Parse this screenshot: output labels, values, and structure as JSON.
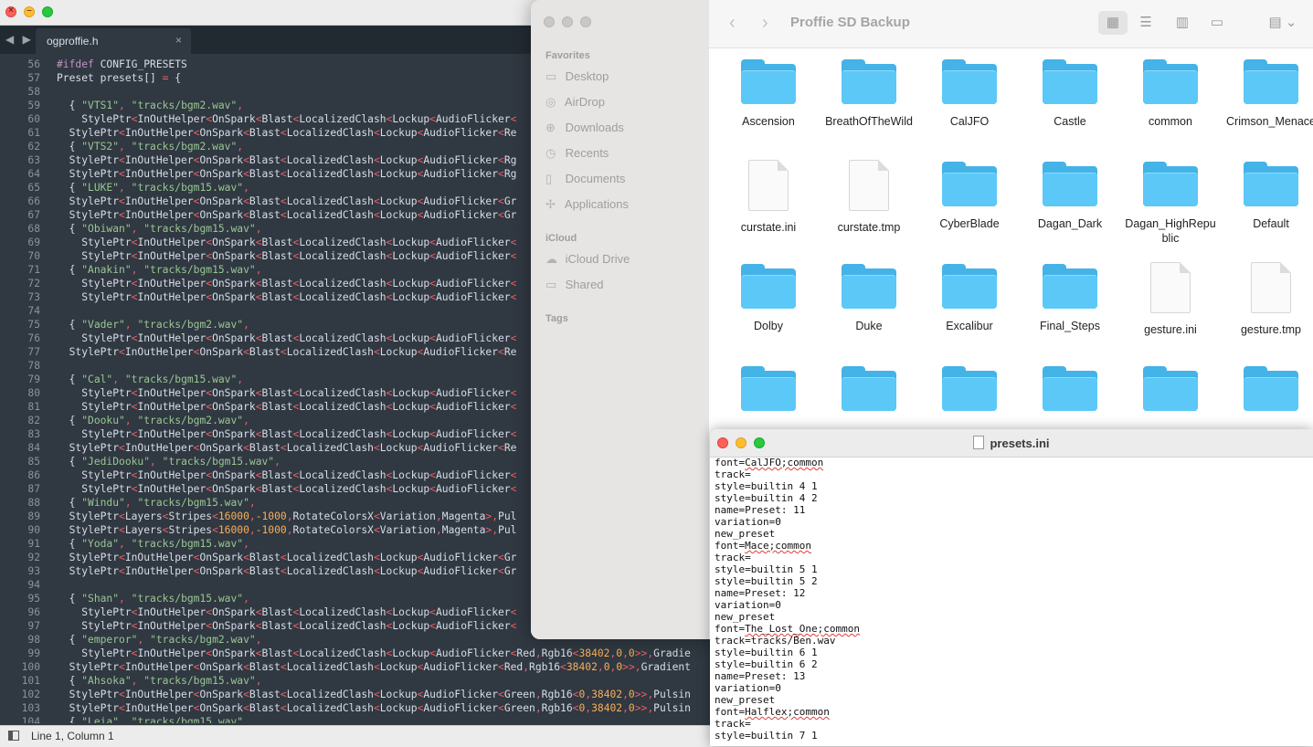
{
  "editor": {
    "tab_title": "ogproffie.h",
    "tab_close": "×",
    "tab_nav": "◀ ▶",
    "status": "Line 1, Column 1",
    "first_line": 56,
    "lines": [
      "#ifdef CONFIG_PRESETS",
      "Preset presets[] = {",
      "",
      "  { \"VTS1\", \"tracks/bgm2.wav\",",
      "    StylePtr<InOutHelper<OnSpark<Blast<LocalizedClash<Lockup<AudioFlicker<",
      "  StylePtr<InOutHelper<OnSpark<Blast<LocalizedClash<Lockup<AudioFlicker<Re",
      "  { \"VTS2\", \"tracks/bgm2.wav\",",
      "  StylePtr<InOutHelper<OnSpark<Blast<LocalizedClash<Lockup<AudioFlicker<Rg",
      "  StylePtr<InOutHelper<OnSpark<Blast<LocalizedClash<Lockup<AudioFlicker<Rg",
      "  { \"LUKE\", \"tracks/bgm15.wav\",",
      "  StylePtr<InOutHelper<OnSpark<Blast<LocalizedClash<Lockup<AudioFlicker<Gr",
      "  StylePtr<InOutHelper<OnSpark<Blast<LocalizedClash<Lockup<AudioFlicker<Gr",
      "  { \"Obiwan\", \"tracks/bgm15.wav\",",
      "    StylePtr<InOutHelper<OnSpark<Blast<LocalizedClash<Lockup<AudioFlicker<",
      "    StylePtr<InOutHelper<OnSpark<Blast<LocalizedClash<Lockup<AudioFlicker<",
      "  { \"Anakin\", \"tracks/bgm15.wav\",",
      "    StylePtr<InOutHelper<OnSpark<Blast<LocalizedClash<Lockup<AudioFlicker<",
      "    StylePtr<InOutHelper<OnSpark<Blast<LocalizedClash<Lockup<AudioFlicker<",
      "",
      "  { \"Vader\", \"tracks/bgm2.wav\",",
      "    StylePtr<InOutHelper<OnSpark<Blast<LocalizedClash<Lockup<AudioFlicker<",
      "  StylePtr<InOutHelper<OnSpark<Blast<LocalizedClash<Lockup<AudioFlicker<Re",
      "",
      "  { \"Cal\", \"tracks/bgm15.wav\",",
      "    StylePtr<InOutHelper<OnSpark<Blast<LocalizedClash<Lockup<AudioFlicker<",
      "    StylePtr<InOutHelper<OnSpark<Blast<LocalizedClash<Lockup<AudioFlicker<",
      "  { \"Dooku\", \"tracks/bgm2.wav\",",
      "    StylePtr<InOutHelper<OnSpark<Blast<LocalizedClash<Lockup<AudioFlicker<",
      "  StylePtr<InOutHelper<OnSpark<Blast<LocalizedClash<Lockup<AudioFlicker<Re",
      "  { \"JediDooku\", \"tracks/bgm15.wav\",",
      "    StylePtr<InOutHelper<OnSpark<Blast<LocalizedClash<Lockup<AudioFlicker<",
      "    StylePtr<InOutHelper<OnSpark<Blast<LocalizedClash<Lockup<AudioFlicker<",
      "  { \"Windu\", \"tracks/bgm15.wav\",",
      "  StylePtr<Layers<Stripes<16000,-1000,RotateColorsX<Variation,Magenta>,Pul",
      "  StylePtr<Layers<Stripes<16000,-1000,RotateColorsX<Variation,Magenta>,Pul",
      "  { \"Yoda\", \"tracks/bgm15.wav\",",
      "  StylePtr<InOutHelper<OnSpark<Blast<LocalizedClash<Lockup<AudioFlicker<Gr",
      "  StylePtr<InOutHelper<OnSpark<Blast<LocalizedClash<Lockup<AudioFlicker<Gr",
      "",
      "  { \"Shan\", \"tracks/bgm15.wav\",",
      "    StylePtr<InOutHelper<OnSpark<Blast<LocalizedClash<Lockup<AudioFlicker<",
      "    StylePtr<InOutHelper<OnSpark<Blast<LocalizedClash<Lockup<AudioFlicker<",
      "  { \"emperor\", \"tracks/bgm2.wav\",",
      "    StylePtr<InOutHelper<OnSpark<Blast<LocalizedClash<Lockup<AudioFlicker<Red,Rgb16<38402,0,0>>,Gradie",
      "  StylePtr<InOutHelper<OnSpark<Blast<LocalizedClash<Lockup<AudioFlicker<Red,Rgb16<38402,0,0>>,Gradient",
      "  { \"Ahsoka\", \"tracks/bgm15.wav\",",
      "  StylePtr<InOutHelper<OnSpark<Blast<LocalizedClash<Lockup<AudioFlicker<Green,Rgb16<0,38402,0>>,Pulsin",
      "  StylePtr<InOutHelper<OnSpark<Blast<LocalizedClash<Lockup<AudioFlicker<Green,Rgb16<0,38402,0>>,Pulsin",
      "  { \"Leia\", \"tracks/bgm15.wav\","
    ]
  },
  "finder": {
    "title": "Proffie SD Backup",
    "nav_back": "‹",
    "nav_forward": "›",
    "sidebar": {
      "favorites_heading": "Favorites",
      "favorites": [
        {
          "label": "Desktop",
          "icon": "▭"
        },
        {
          "label": "AirDrop",
          "icon": "◎"
        },
        {
          "label": "Downloads",
          "icon": "⊕"
        },
        {
          "label": "Recents",
          "icon": "◷"
        },
        {
          "label": "Documents",
          "icon": "▯"
        },
        {
          "label": "Applications",
          "icon": "✢"
        }
      ],
      "icloud_heading": "iCloud",
      "icloud": [
        {
          "label": "iCloud Drive",
          "icon": "☁"
        },
        {
          "label": "Shared",
          "icon": "▭"
        }
      ],
      "tags_heading": "Tags"
    },
    "view_buttons": [
      "▦",
      "☰",
      "▥",
      "▭",
      "▤ ⌄"
    ],
    "items": [
      {
        "name": "Ascension",
        "kind": "folder"
      },
      {
        "name": "BreathOfTheWild",
        "kind": "folder"
      },
      {
        "name": "CalJFO",
        "kind": "folder"
      },
      {
        "name": "Castle",
        "kind": "folder"
      },
      {
        "name": "common",
        "kind": "folder"
      },
      {
        "name": "Crimson_Menace",
        "kind": "folder"
      },
      {
        "name": "curstate.ini",
        "kind": "file"
      },
      {
        "name": "curstate.tmp",
        "kind": "file"
      },
      {
        "name": "CyberBlade",
        "kind": "folder"
      },
      {
        "name": "Dagan_Dark",
        "kind": "folder"
      },
      {
        "name": "Dagan_HighRepublic",
        "kind": "folder"
      },
      {
        "name": "Default",
        "kind": "folder"
      },
      {
        "name": "Dolby",
        "kind": "folder"
      },
      {
        "name": "Duke",
        "kind": "folder"
      },
      {
        "name": "Excalibur",
        "kind": "folder"
      },
      {
        "name": "Final_Steps",
        "kind": "folder"
      },
      {
        "name": "gesture.ini",
        "kind": "file"
      },
      {
        "name": "gesture.tmp",
        "kind": "file"
      },
      {
        "name": "",
        "kind": "folder"
      },
      {
        "name": "",
        "kind": "folder"
      },
      {
        "name": "",
        "kind": "folder"
      },
      {
        "name": "",
        "kind": "folder"
      },
      {
        "name": "",
        "kind": "folder"
      },
      {
        "name": "",
        "kind": "folder"
      }
    ]
  },
  "ini": {
    "title": "presets.ini",
    "lines": [
      "font=CalJFO;common",
      "track=",
      "style=builtin 4 1",
      "style=builtin 4 2",
      "name=Preset: 11",
      "variation=0",
      "new_preset",
      "font=Mace;common",
      "track=",
      "style=builtin 5 1",
      "style=builtin 5 2",
      "name=Preset: 12",
      "variation=0",
      "new_preset",
      "font=The_Lost_One;common",
      "track=tracks/Ben.wav",
      "style=builtin 6 1",
      "style=builtin 6 2",
      "name=Preset: 13",
      "variation=0",
      "new_preset",
      "font=Halflex;common",
      "track=",
      "style=builtin 7 1"
    ]
  }
}
